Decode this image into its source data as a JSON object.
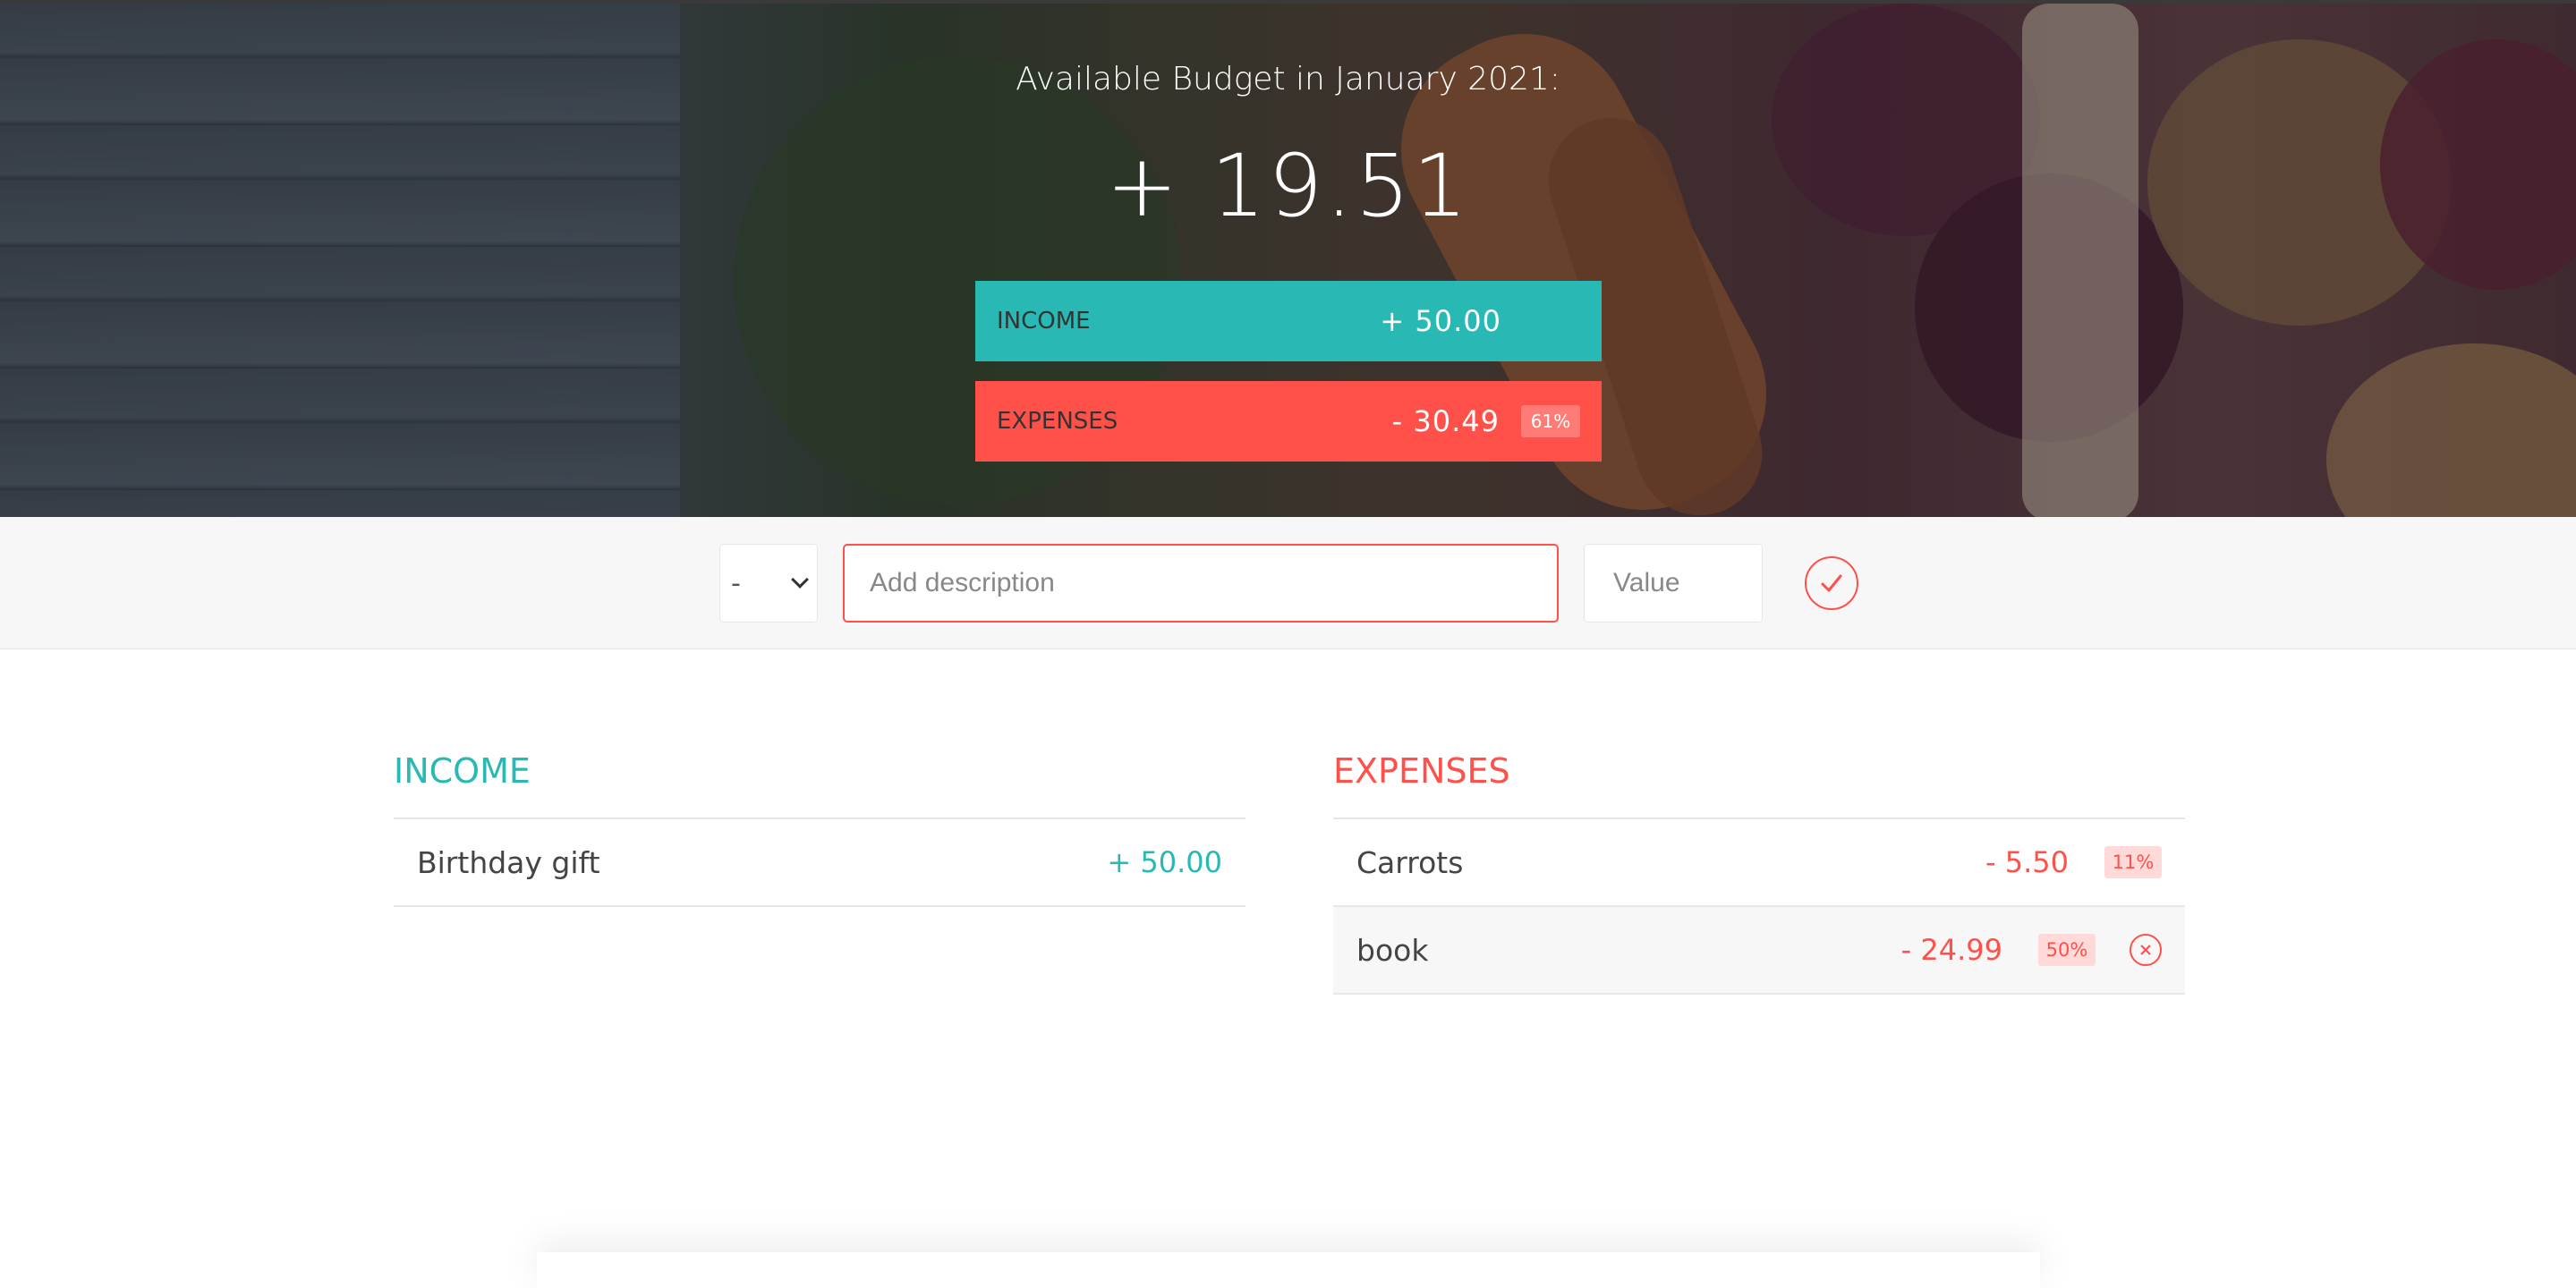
{
  "budget": {
    "title": "Available Budget in January 2021:",
    "value": "+ 19.51",
    "income_label": "Income",
    "income_value": "+ 50.00",
    "expenses_label": "Expenses",
    "expenses_value": "- 30.49",
    "expenses_percentage": "61%"
  },
  "add": {
    "type_selected": "-",
    "description_placeholder": "Add description",
    "value_placeholder": "Value",
    "submit_icon": "checkmark-circle-icon"
  },
  "income": {
    "title": "Income",
    "items": [
      {
        "description": "Birthday gift",
        "value": "+ 50.00"
      }
    ]
  },
  "expenses": {
    "title": "Expenses",
    "items": [
      {
        "description": "Carrots",
        "value": "- 5.50",
        "percentage": "11%"
      },
      {
        "description": "book",
        "value": "- 24.99",
        "percentage": "50%",
        "delete_icon": "close-circle-icon"
      }
    ]
  },
  "colors": {
    "income": "#28b9b5",
    "expenses": "#ff5049"
  }
}
